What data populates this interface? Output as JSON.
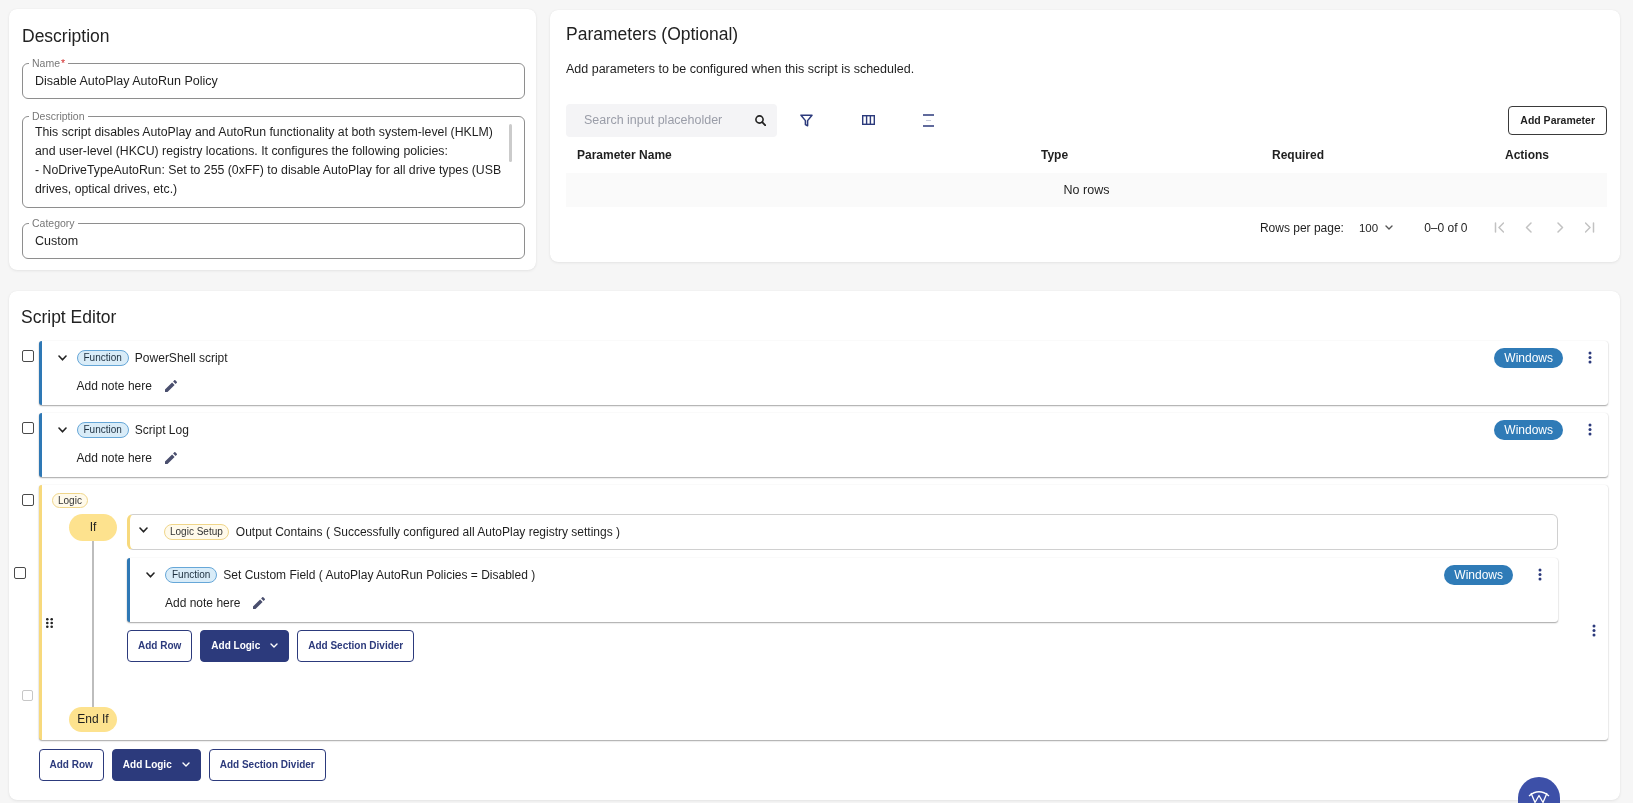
{
  "description": {
    "title": "Description",
    "fields": [
      {
        "kind": "input",
        "label": "Name",
        "required_mark": "*",
        "value": "Disable AutoPlay AutoRun Policy"
      },
      {
        "kind": "textarea",
        "label": "Description",
        "value": "This script disables AutoPlay and AutoRun functionality at both system-level (HKLM) and user-level (HKCU) registry locations. It configures the following policies:\n- NoDriveTypeAutoRun: Set to 255 (0xFF) to disable AutoPlay for all drive types (USB drives, optical drives, etc.)"
      },
      {
        "kind": "input",
        "label": "Category",
        "value": "Custom"
      }
    ]
  },
  "parameters": {
    "title": "Parameters (Optional)",
    "subtitle": "Add parameters to be configured when this script is scheduled.",
    "search": {
      "placeholder": "Search input placeholder"
    },
    "add_button": "Add Parameter",
    "table": {
      "columns": [
        "Parameter Name",
        "Type",
        "Required",
        "Actions"
      ],
      "empty_text": "No rows"
    },
    "pagination": {
      "label": "Rows per page:",
      "rows_per_page": "100",
      "range": "0–0 of 0",
      "nav_disabled": true
    }
  },
  "script_editor": {
    "title": "Script Editor",
    "items": [
      {
        "kind": "function",
        "checked": false,
        "expanded": true,
        "tag": "Function",
        "name": "PowerShell script",
        "note": "Add note here",
        "platform": "Windows"
      },
      {
        "kind": "function",
        "checked": false,
        "expanded": true,
        "tag": "Function",
        "name": "Script Log",
        "note": "Add note here",
        "platform": "Windows"
      },
      {
        "kind": "logic",
        "checked": false,
        "tag": "Logic",
        "if_label": "If",
        "end_label": "End If",
        "end_checkbox": {
          "checked": false,
          "disabled": true
        },
        "condition": {
          "expanded": true,
          "tag": "Logic Setup",
          "text": "Output Contains ( Successfully configured all AutoPlay registry settings )"
        },
        "children": [
          {
            "kind": "function",
            "checked": false,
            "expanded": true,
            "tag": "Function",
            "name": "Set Custom Field ( AutoPlay AutoRun Policies = Disabled )",
            "note": "Add note here",
            "platform": "Windows"
          }
        ],
        "buttons": [
          {
            "kind": "outline",
            "label": "Add Row"
          },
          {
            "kind": "menu",
            "label": "Add Logic"
          },
          {
            "kind": "outline",
            "label": "Add Section Divider"
          }
        ]
      }
    ],
    "buttons": [
      {
        "kind": "outline",
        "label": "Add Row"
      },
      {
        "kind": "menu",
        "label": "Add Logic"
      },
      {
        "kind": "outline",
        "label": "Add Section Divider"
      }
    ]
  }
}
